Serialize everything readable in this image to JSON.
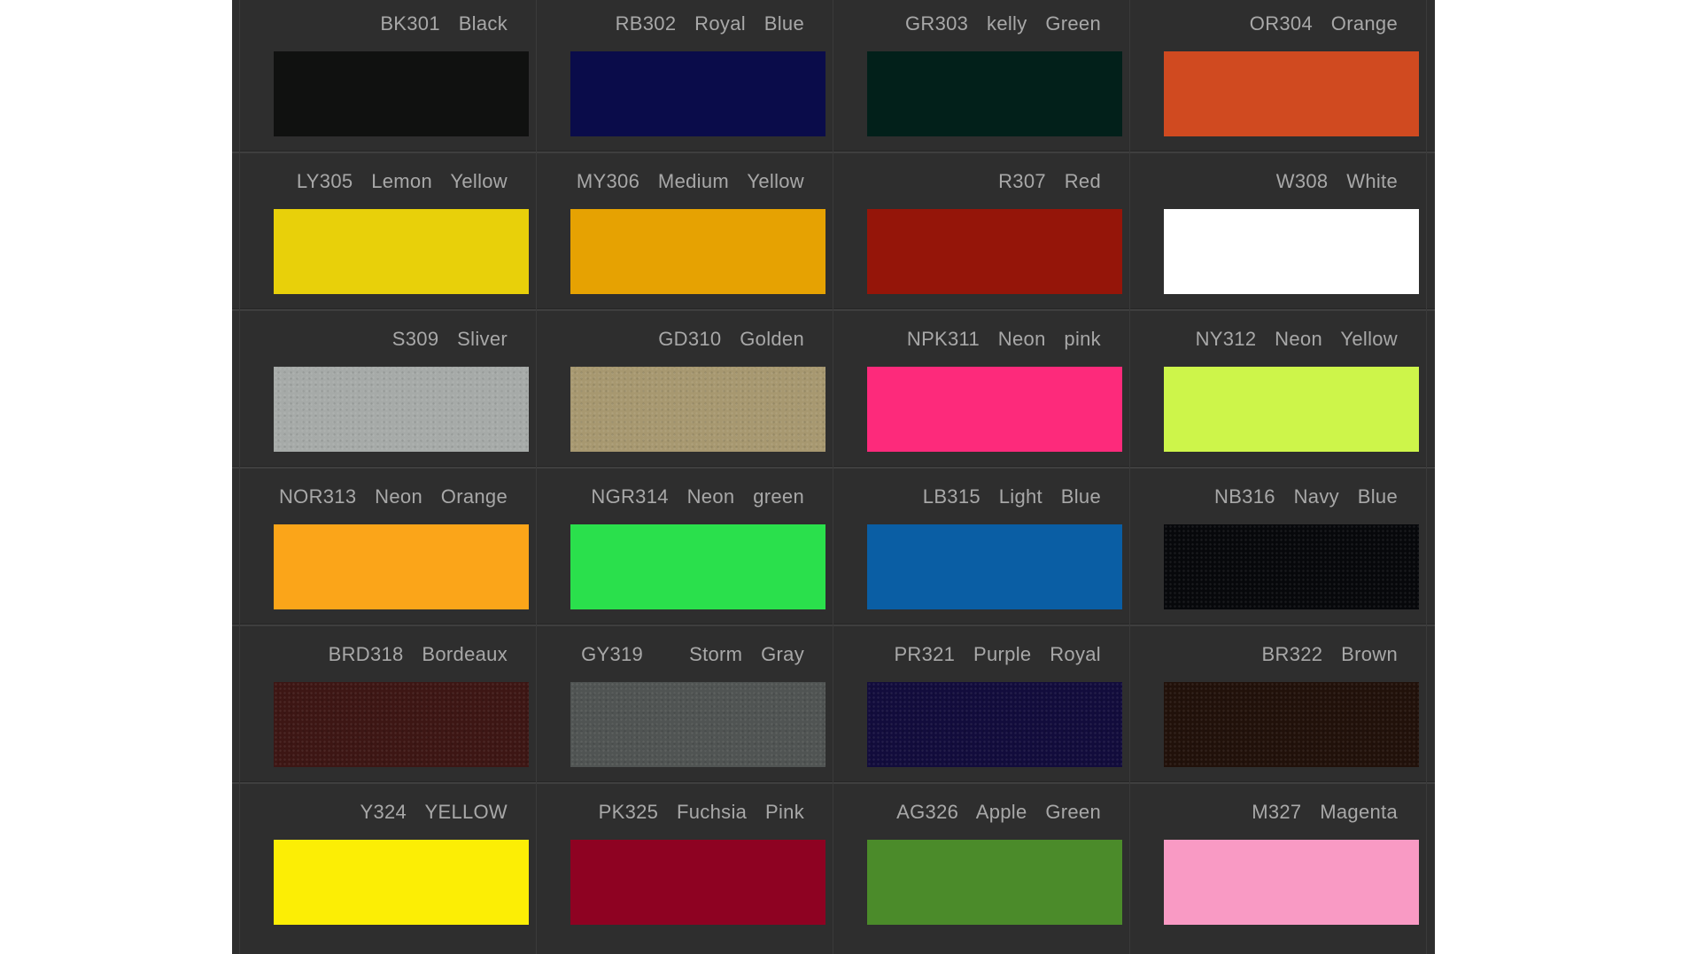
{
  "swatches": [
    [
      {
        "label": "BK301  Black",
        "color": "#101110",
        "textured": false
      },
      {
        "label": "RB302  Royal  Blue",
        "color": "#0a0c4a",
        "textured": false
      },
      {
        "label": "GR303  kelly  Green",
        "color": "#02201a",
        "textured": false
      },
      {
        "label": "OR304  Orange",
        "color": "#d04a20",
        "textured": false
      }
    ],
    [
      {
        "label": "LY305  Lemon  Yellow",
        "color": "#e8d00a",
        "textured": false
      },
      {
        "label": "MY306  Medium  Yellow",
        "color": "#e6a202",
        "textured": false
      },
      {
        "label": "R307  Red",
        "color": "#951509",
        "textured": false
      },
      {
        "label": "W308  White",
        "color": "#ffffff",
        "textured": false
      }
    ],
    [
      {
        "label": "S309  Sliver",
        "color": "#a6aaa8",
        "textured": true
      },
      {
        "label": "GD310  Golden",
        "color": "#a79870",
        "textured": true
      },
      {
        "label": "NPK311  Neon  pink",
        "color": "#fd2a7b",
        "textured": false
      },
      {
        "label": "NY312  Neon  Yellow",
        "color": "#cdf54a",
        "textured": false
      }
    ],
    [
      {
        "label": "NOR313  Neon  Orange",
        "color": "#fba519",
        "textured": false
      },
      {
        "label": "NGR314  Neon  green",
        "color": "#2ae04c",
        "textured": false
      },
      {
        "label": "LB315  Light  Blue",
        "color": "#0a5ea4",
        "textured": false
      },
      {
        "label": "NB316  Navy  Blue",
        "color": "#07080b",
        "textured": true
      }
    ],
    [
      {
        "label": "BRD318  Bordeaux",
        "color": "#3d1614",
        "textured": true
      },
      {
        "label": "GY319     Storm  Gray",
        "color": "#505453",
        "textured": true
      },
      {
        "label": "PR321  Purple  Royal",
        "color": "#120c3c",
        "textured": true
      },
      {
        "label": "BR322  Brown",
        "color": "#21110a",
        "textured": true
      }
    ],
    [
      {
        "label": "Y324  YELLOW",
        "color": "#fcee05",
        "textured": false
      },
      {
        "label": "PK325  Fuchsia  Pink",
        "color": "#8e0222",
        "textured": false
      },
      {
        "label": "AG326  Apple  Green",
        "color": "#4b8b2a",
        "textured": false
      },
      {
        "label": "M327  Magenta",
        "color": "#f99ac4",
        "textured": false
      }
    ]
  ]
}
